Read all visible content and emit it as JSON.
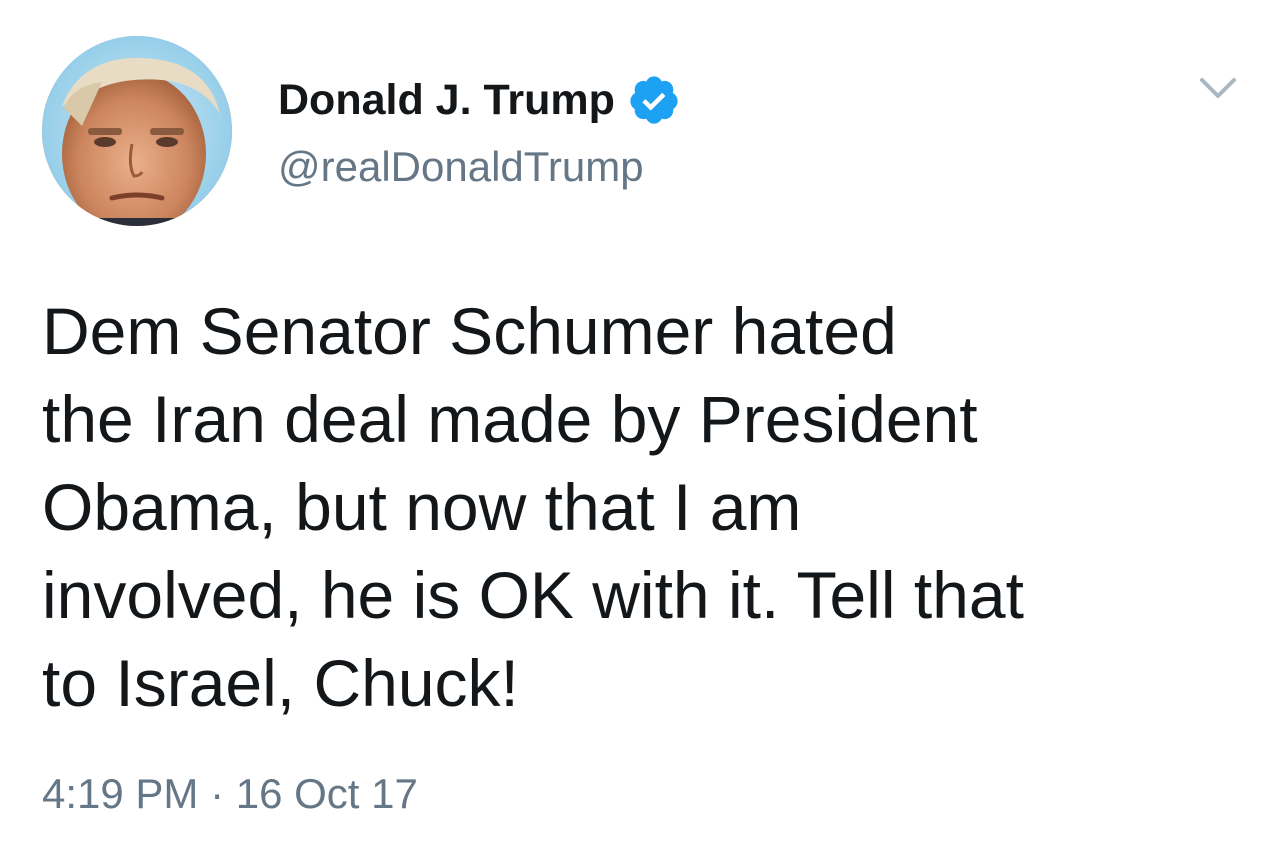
{
  "tweet": {
    "author": {
      "name": "Donald J. Trump",
      "handle": "@realDonaldTrump",
      "verified": true,
      "avatar_icon": "profile-photo"
    },
    "text": "Dem Senator Schumer hated\nthe Iran deal made by President\nObama, but now that I am\ninvolved, he is OK with it. Tell that\nto Israel, Chuck!",
    "timestamp": "4:19 PM · 16 Oct 17",
    "menu_icon": "chevron-down-icon"
  },
  "colors": {
    "text_primary": "#14171a",
    "text_secondary": "#657786",
    "verified_blue": "#1da1f2",
    "chevron_gray": "#aab8c2",
    "background": "#ffffff"
  }
}
